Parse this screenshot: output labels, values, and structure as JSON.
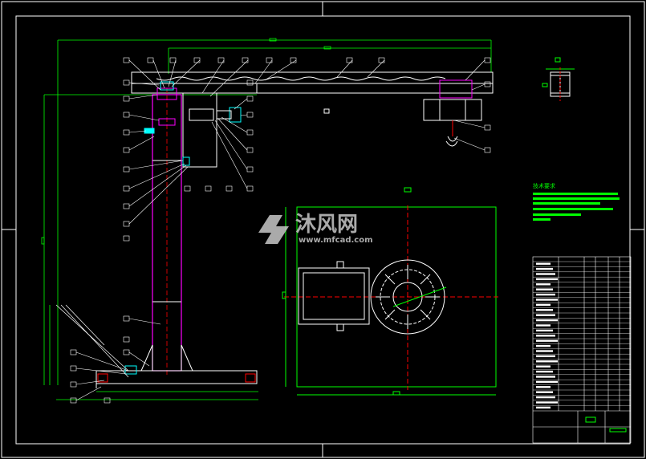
{
  "drawing": {
    "watermark_brand": "沐风网",
    "watermark_url": "www.mfcad.com",
    "notes_heading": "技术要求",
    "colors": {
      "background": "#000000",
      "frame": "#ffffff",
      "dimension": "#00ff00",
      "outline": "#ffffff",
      "centerline": "#ff0000",
      "magenta": "#ff00ff",
      "cyan": "#00ffff",
      "watermark": "#c8c8c8"
    }
  }
}
